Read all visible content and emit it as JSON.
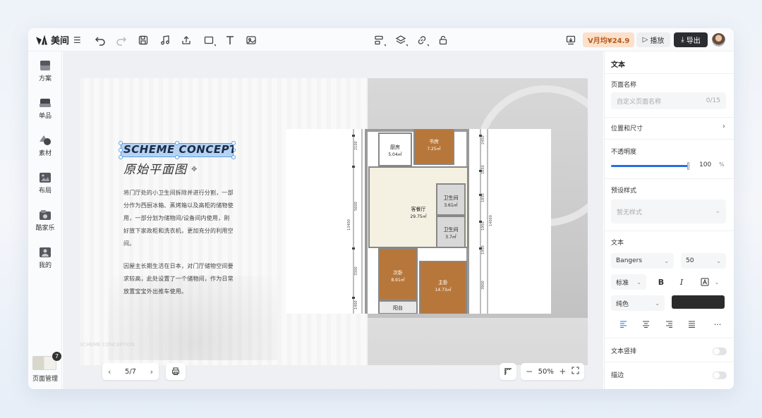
{
  "app": {
    "logo_text": "美间",
    "menu_glyph": "☰"
  },
  "toolbar": {
    "price_label": "V月均¥24.9",
    "play_label": "播放",
    "export_label": "导出"
  },
  "sidebar": {
    "items": [
      {
        "label": "方案",
        "icon": "scheme-icon"
      },
      {
        "label": "单品",
        "icon": "product-icon"
      },
      {
        "label": "素材",
        "icon": "material-icon"
      },
      {
        "label": "布局",
        "icon": "layout-icon"
      },
      {
        "label": "酷家乐",
        "icon": "kujiale-icon"
      },
      {
        "label": "我的",
        "icon": "mine-icon"
      }
    ],
    "page_count_badge": "7",
    "page_manager_label": "页面管理"
  },
  "slide": {
    "title_en": "SCHEME CONCEPTION",
    "title_cn": "原始平面图",
    "paragraph1": "将门厅处的小卫生间拆除并进行分割，一部分作为西厨冰箱、蒸烤箱以及高柜的储物使用，一部分划为储物间/设备间内使用，刚好放下家政柜和洗衣机，更加充分的利用空间。",
    "paragraph2": "因屋主长期生活在日本，对门厅储物空间要求较高，此处设置了一个储物间，作为日常放置宝宝外出推车使用。",
    "faint_caption": "SCHEME CONCEPTION"
  },
  "floorplan": {
    "rooms": [
      {
        "name": "厨房",
        "area": "5.04㎡"
      },
      {
        "name": "书房",
        "area": "7.25㎡"
      },
      {
        "name": "客餐厅",
        "area": "29.75㎡"
      },
      {
        "name": "卫生间",
        "area": "3.61㎡"
      },
      {
        "name": "卫生间",
        "area": "3.7㎡"
      },
      {
        "name": "次卧",
        "area": "8.91㎡"
      },
      {
        "name": "主卧",
        "area": "14.73㎡"
      },
      {
        "name": "阳台",
        "area": ""
      }
    ],
    "dims_left": [
      "2100",
      "5600",
      "3300",
      "1400"
    ],
    "dims_total_left": "13400",
    "dims_right": [
      "2450",
      "1650",
      "1850",
      "1950",
      "1950",
      "3900"
    ],
    "dims_total_right": "14000"
  },
  "canvas_controls": {
    "page_indicator": "5/7",
    "zoom_level": "50%",
    "help_label": "?"
  },
  "panel": {
    "title": "文本",
    "page_name_label": "页面名称",
    "page_name_placeholder": "自定义页面名称",
    "page_name_count": "0/15",
    "position_size_label": "位置和尺寸",
    "opacity_label": "不透明度",
    "opacity_value": "100",
    "opacity_unit": "%",
    "opacity_fraction": 1.0,
    "preset_label": "预设样式",
    "preset_value": "暂无样式",
    "text_label": "文本",
    "font_family_value": "Bangers",
    "font_size_value": "50",
    "weight_value": "标准",
    "bold_label": "B",
    "italic_label": "I",
    "fill_value": "纯色",
    "fill_color": "#2b2b2b",
    "more_label": "···",
    "vertical_text_label": "文本竖排",
    "stroke_label": "描边"
  },
  "colors": {
    "accent": "#2a6fe0",
    "price_bg": "#fbe0cb",
    "price_fg": "#b85a1b",
    "export_bg": "#2b2d31",
    "selection": "#5b9fe6"
  }
}
